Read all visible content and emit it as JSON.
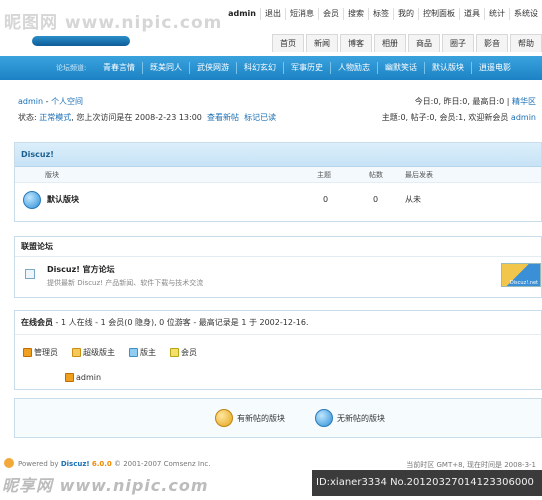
{
  "watermark": {
    "top": "昵图网 www.nipic.com",
    "bottom": "昵享网 www.nipic.com"
  },
  "topnav": [
    "admin",
    "退出",
    "短消息",
    "会员",
    "搜索",
    "标签",
    "我的",
    "控制面板",
    "道具",
    "统计",
    "系统设"
  ],
  "tabs": [
    "首页",
    "新闻",
    "博客",
    "相册",
    "商品",
    "圈子",
    "影音",
    "帮助"
  ],
  "bluenav": {
    "label": "论坛频道:",
    "items": [
      "青春言情",
      "既美同人",
      "武侠网游",
      "科幻玄幻",
      "军事历史",
      "人物励志",
      "幽默笑话",
      "默认版块",
      "逍遥电影"
    ]
  },
  "user": {
    "name": "admin",
    "space": "个人空间"
  },
  "status": {
    "prefix": "状态:",
    "mode": "正常模式",
    "visit": ", 您上次访问是在 2008-2-23 13:00",
    "new_posts": "查看新帖",
    "mark_read": "标记已读"
  },
  "stats": {
    "line1": "今日:0, 昨日:0, 最高日:0",
    "best": "精华区",
    "line2": "主题:0, 帖子:0, 会员:1, 欢迎新会员",
    "newmember": "admin"
  },
  "forum": {
    "header": "Discuz!",
    "columns": {
      "board": "版块",
      "topics": "主题",
      "posts": "帖数",
      "last": "最后发表"
    },
    "rows": [
      {
        "name": "默认版块",
        "topics": "0",
        "posts": "0",
        "last": "从未"
      }
    ]
  },
  "league": {
    "header": "联盟论坛",
    "title": "Discuz! 官方论坛",
    "desc": "提供最新 Discuz! 产品新闻、软件下载与技术交流",
    "logo_text": "Discuz!.net"
  },
  "online": {
    "header_bold": "在线会员",
    "header_rest": " - 1 人在线 - 1 会员(0 隐身), 0 位游客 - 最高记录是 1 于 2002-12-16.",
    "legend": [
      "管理员",
      "超级版主",
      "版主",
      "会员"
    ],
    "user": "admin"
  },
  "legend2": {
    "new": "有新帖的版块",
    "none": "无新帖的版块"
  },
  "footer": {
    "powered": "Powered by",
    "brand": "Discuz!",
    "version": "6.0.0",
    "copy": "© 2001-2007 Comsenz Inc.",
    "timezone": "当前时区 GMT+8, 现在时间是 2008-3-1"
  },
  "id_strip": "ID:xianer3334 No.20120327014123306000"
}
